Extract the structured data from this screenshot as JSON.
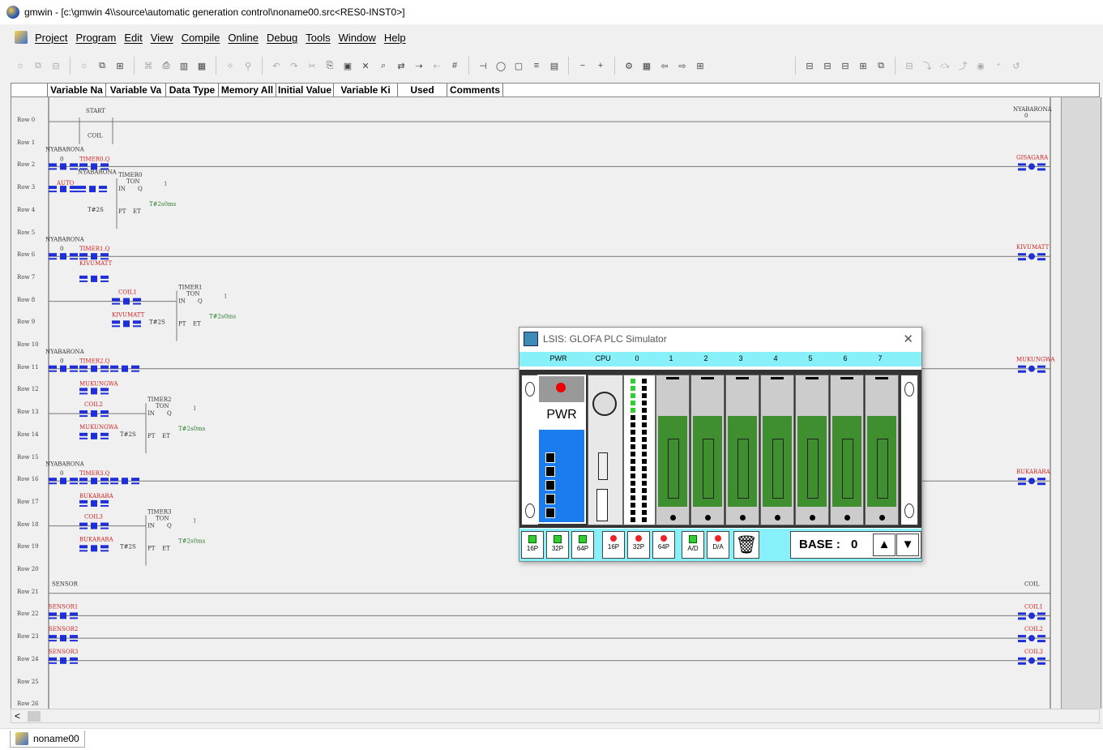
{
  "window": {
    "title": "gmwin - [c:\\gmwin 4\\\\source\\automatic generation control\\noname00.src<RES0-INST0>]"
  },
  "menu": [
    "Project",
    "Program",
    "Edit",
    "View",
    "Compile",
    "Online",
    "Debug",
    "Tools",
    "Window",
    "Help"
  ],
  "header": {
    "columns": [
      "",
      "Variable Na",
      "Variable Va",
      "Data Type",
      "Memory All",
      "Initial Value",
      "Variable Ki",
      "Used",
      "Comments"
    ]
  },
  "rows": [
    "Row 0",
    "Row 1",
    "Row 2",
    "Row 3",
    "Row 4",
    "Row 5",
    "Row 6",
    "Row 7",
    "Row 8",
    "Row 9",
    "Row 10",
    "Row 11",
    "Row 12",
    "Row 13",
    "Row 14",
    "Row 15",
    "Row 16",
    "Row 17",
    "Row 18",
    "Row 19",
    "Row 20",
    "Row 21",
    "Row 22",
    "Row 23",
    "Row 24",
    "Row 25",
    "Row 26"
  ],
  "ladder": {
    "start": "START",
    "coil": "COIL",
    "nyabarona": "NYABARONA",
    "zero": "0",
    "timer0q": "TIMER0.Q",
    "auto": "AUTO",
    "timer0": "TIMER0",
    "ton": "TON",
    "in": "IN",
    "q": "Q",
    "one": "1",
    "t2s": "T#2S",
    "pt": "PT",
    "et": "ET",
    "t2s0ms": "T#2s0ms",
    "timer1q": "TIMER1.Q",
    "kivumatt": "KIVUMATT",
    "coil1": "COIL1",
    "timer1": "TIMER1",
    "timer2q": "TIMER2.Q",
    "gisagara": "GISAGARA",
    "mukungwa": "MUKUNGWA",
    "coil2": "COIL2",
    "timer2": "TIMER2",
    "timer3q": "TIMER3.Q",
    "bukarara": "BUKARARA",
    "coil3": "COIL3",
    "timer3": "TIMER3",
    "sensor": "SENSOR",
    "sensor1": "SENSOR1",
    "sensor2": "SENSOR2",
    "sensor3": "SENSOR3"
  },
  "simulator": {
    "title": "LSIS: GLOFA PLC Simulator",
    "slot_labels": [
      "PWR",
      "CPU",
      "0",
      "1",
      "2",
      "3",
      "4",
      "5",
      "6",
      "7"
    ],
    "pwr_label": "PWR",
    "module_buttons": [
      "16P",
      "32P",
      "64P",
      "16P",
      "32P",
      "64P",
      "A/D",
      "D/A"
    ],
    "base_label": "BASE :",
    "base_value": "0",
    "up": "▲",
    "down": "▼"
  },
  "tabs": [
    "noname00"
  ],
  "colors": {
    "contact_blue": "#1f2fd6",
    "label_red": "#d61f1f",
    "timer_green": "#2f7f2f",
    "simulator_cyan": "#88f0f8"
  }
}
